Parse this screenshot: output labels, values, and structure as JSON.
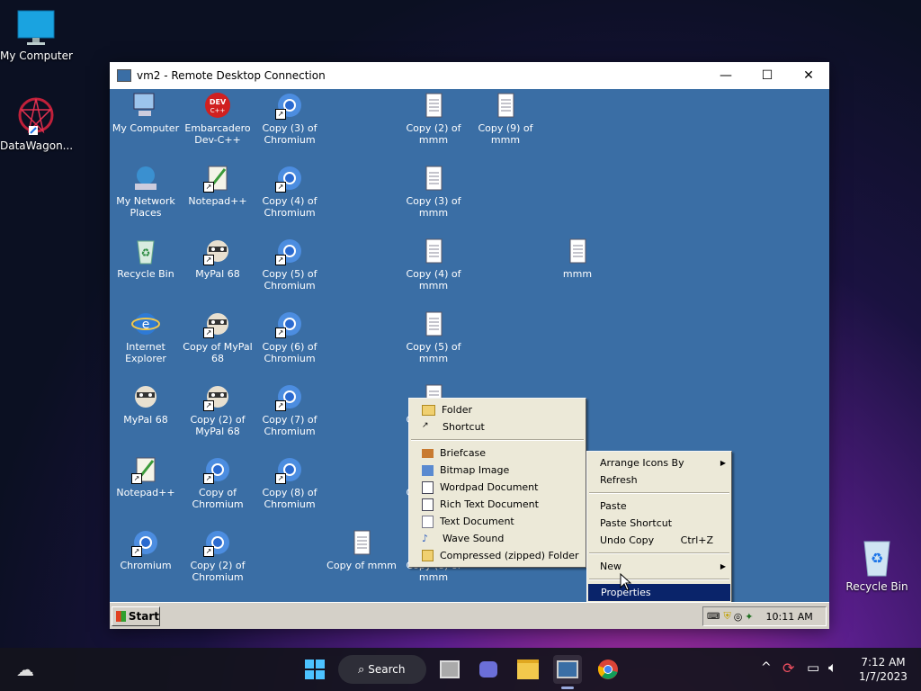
{
  "host_desktop": {
    "icons": [
      {
        "label": "My Computer"
      },
      {
        "label": "DataWagon..."
      },
      {
        "label": "Recycle Bin"
      }
    ]
  },
  "rdp_window": {
    "title": "vm2 - Remote Desktop Connection",
    "controls": {
      "minimize": "—",
      "maximize": "☐",
      "close": "✕"
    }
  },
  "xp_desktop": {
    "icons": [
      {
        "label": "My Computer",
        "icon": "computer-icon"
      },
      {
        "label": "My Network Places",
        "icon": "network-icon"
      },
      {
        "label": "Recycle Bin",
        "icon": "recycle-bin-icon"
      },
      {
        "label": "Internet Explorer",
        "icon": "ie-icon"
      },
      {
        "label": "MyPal 68",
        "icon": "mypal-icon"
      },
      {
        "label": "Notepad++",
        "icon": "notepadpp-icon"
      },
      {
        "label": "Chromium",
        "icon": "chromium-icon"
      },
      {
        "label": "Embarcadero Dev-C++",
        "icon": "devcpp-icon"
      },
      {
        "label": "Notepad++",
        "icon": "notepadpp-icon"
      },
      {
        "label": "MyPal 68",
        "icon": "mypal-icon"
      },
      {
        "label": "Copy of MyPal 68",
        "icon": "mypal-icon"
      },
      {
        "label": "Copy (2) of MyPal 68",
        "icon": "mypal-icon"
      },
      {
        "label": "Copy of Chromium",
        "icon": "chromium-icon"
      },
      {
        "label": "Copy (2) of Chromium",
        "icon": "chromium-icon"
      },
      {
        "label": "Copy (3) of Chromium",
        "icon": "chromium-icon"
      },
      {
        "label": "Copy (4) of Chromium",
        "icon": "chromium-icon"
      },
      {
        "label": "Copy (5) of Chromium",
        "icon": "chromium-icon"
      },
      {
        "label": "Copy (6) of Chromium",
        "icon": "chromium-icon"
      },
      {
        "label": "Copy (7) of Chromium",
        "icon": "chromium-icon"
      },
      {
        "label": "Copy (8) of Chromium",
        "icon": "chromium-icon"
      },
      {
        "label": "Copy of mmm",
        "icon": "text-file-icon"
      },
      {
        "label": "Copy (2) of mmm",
        "icon": "text-file-icon"
      },
      {
        "label": "Copy (3) of mmm",
        "icon": "text-file-icon"
      },
      {
        "label": "Copy (4) of mmm",
        "icon": "text-file-icon"
      },
      {
        "label": "Copy (5) of mmm",
        "icon": "text-file-icon"
      },
      {
        "label": "Copy (6) of mmm",
        "icon": "text-file-icon"
      },
      {
        "label": "Copy (7) of mmm",
        "icon": "text-file-icon"
      },
      {
        "label": "Copy (8) of mmm",
        "icon": "text-file-icon"
      },
      {
        "label": "Copy (9) of mmm",
        "icon": "text-file-icon"
      },
      {
        "label": "mmm",
        "icon": "text-file-icon"
      }
    ],
    "new_submenu": [
      {
        "label": "Folder"
      },
      {
        "label": "Shortcut"
      },
      {
        "label": "Briefcase"
      },
      {
        "label": "Bitmap Image"
      },
      {
        "label": "Wordpad Document"
      },
      {
        "label": "Rich Text Document"
      },
      {
        "label": "Text Document"
      },
      {
        "label": "Wave Sound"
      },
      {
        "label": "Compressed (zipped) Folder"
      }
    ],
    "context_menu": {
      "arrange": "Arrange Icons By",
      "refresh": "Refresh",
      "paste": "Paste",
      "paste_shortcut": "Paste Shortcut",
      "undo_copy": "Undo Copy",
      "undo_shortcut": "Ctrl+Z",
      "new": "New",
      "properties": "Properties"
    },
    "taskbar": {
      "start": "Start",
      "clock": "10:11 AM"
    }
  },
  "win11_taskbar": {
    "search": "Search",
    "time": "7:12 AM",
    "date": "1/7/2023"
  }
}
